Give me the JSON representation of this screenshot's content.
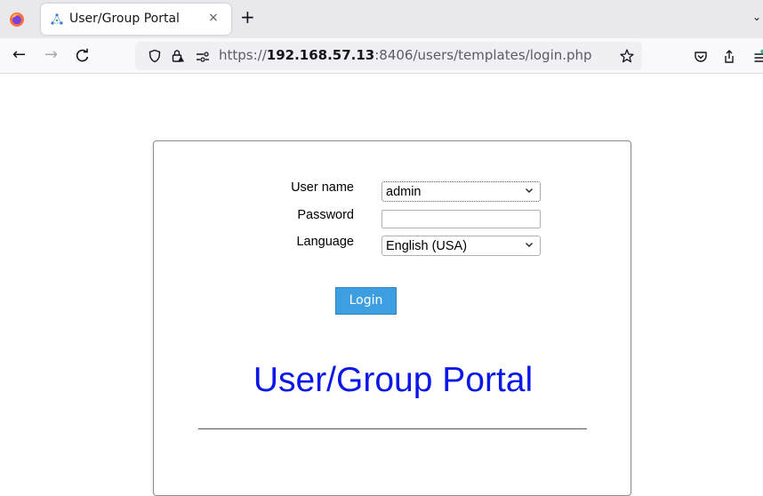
{
  "browser": {
    "tab_title": "User/Group Portal",
    "tab_close": "×",
    "new_tab": "+",
    "tab_list": "⌄",
    "url_scheme": "https://",
    "url_host": "192.168.57.13",
    "url_rest": ":8406/users/templates/login.php"
  },
  "nav": {
    "back": "←",
    "forward": "→",
    "reload": "C"
  },
  "form": {
    "username_label": "User name",
    "username_value": "admin",
    "password_label": "Password",
    "password_value": "",
    "language_label": "Language",
    "language_value": "English (USA)",
    "login_label": "Login"
  },
  "portal": {
    "title": "User/Group Portal"
  },
  "colors": {
    "title": "#0b17e6",
    "button": "#3d9fe0"
  }
}
